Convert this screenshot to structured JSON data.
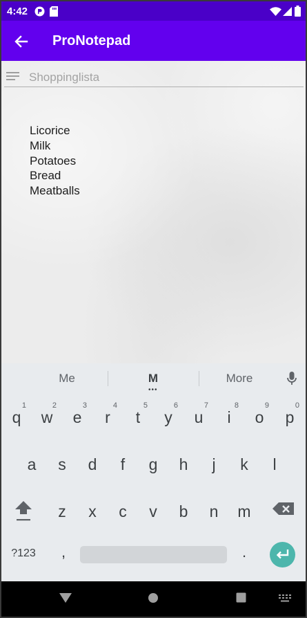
{
  "status_bar": {
    "time": "4:42",
    "icons": [
      "data-saver-icon",
      "sd-card-icon",
      "wifi-icon",
      "signal-icon",
      "battery-icon"
    ]
  },
  "app_bar": {
    "title": "ProNotepad",
    "back_icon": "arrow-left-icon",
    "background": "#6200ee"
  },
  "note": {
    "title_placeholder": "Shoppinglista",
    "lines": [
      "Licorice",
      "Milk",
      "Potatoes",
      "Bread",
      "Meatballs"
    ]
  },
  "keyboard": {
    "suggestions": [
      "Me",
      "M",
      "More"
    ],
    "rows": [
      [
        {
          "key": "q",
          "num": "1"
        },
        {
          "key": "w",
          "num": "2"
        },
        {
          "key": "e",
          "num": "3"
        },
        {
          "key": "r",
          "num": "4"
        },
        {
          "key": "t",
          "num": "5"
        },
        {
          "key": "y",
          "num": "6"
        },
        {
          "key": "u",
          "num": "7"
        },
        {
          "key": "i",
          "num": "8"
        },
        {
          "key": "o",
          "num": "9"
        },
        {
          "key": "p",
          "num": "0"
        }
      ],
      [
        {
          "key": "a"
        },
        {
          "key": "s"
        },
        {
          "key": "d"
        },
        {
          "key": "f"
        },
        {
          "key": "g"
        },
        {
          "key": "h"
        },
        {
          "key": "j"
        },
        {
          "key": "k"
        },
        {
          "key": "l"
        }
      ],
      [
        {
          "key": "z"
        },
        {
          "key": "x"
        },
        {
          "key": "c"
        },
        {
          "key": "v"
        },
        {
          "key": "b"
        },
        {
          "key": "n"
        },
        {
          "key": "m"
        }
      ]
    ],
    "symbols_label": "?123",
    "comma_label": ",",
    "period_label": ".",
    "enter_color": "#4db6ac"
  },
  "nav_bar": {
    "icons": [
      "back-triangle-icon",
      "home-circle-icon",
      "recents-square-icon",
      "keyboard-switch-icon"
    ]
  }
}
